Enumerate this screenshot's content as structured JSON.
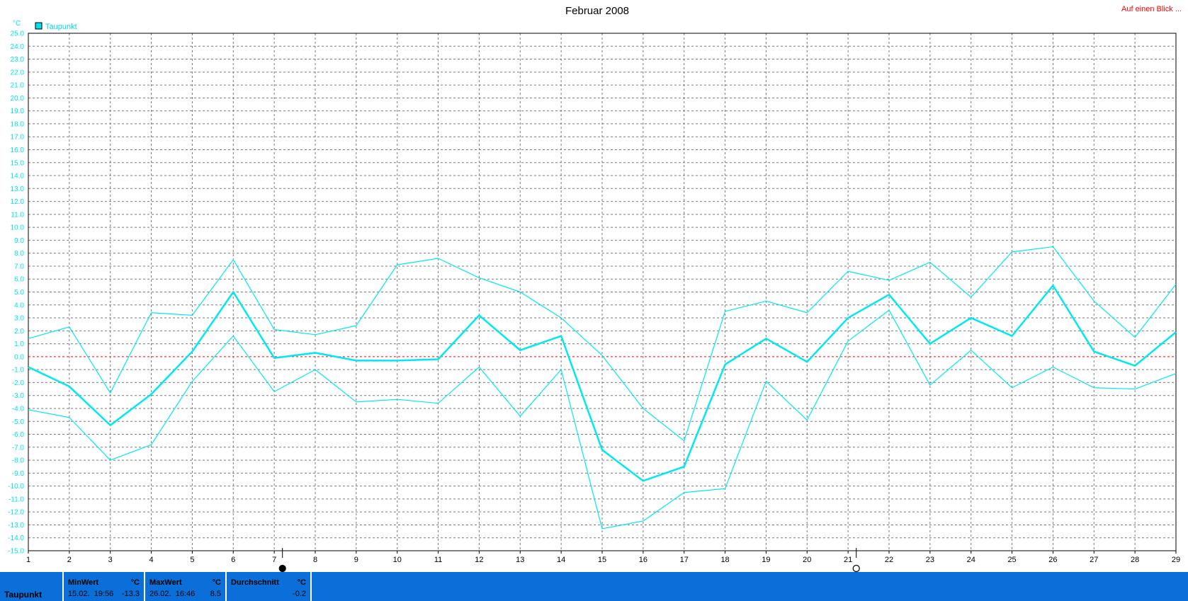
{
  "page_title": "Februar 2008",
  "link_label": "Auf einen Blick ...",
  "y_unit": "°C",
  "colors": {
    "series": "#00e8f0",
    "zero_line": "#ff0000",
    "grid": "#7a7a7a",
    "stats_bar": "#0a6fd8"
  },
  "chart_data": {
    "type": "line",
    "title": "Februar 2008",
    "ylabel": "°C",
    "xlabel": "",
    "ylim": [
      -15,
      25
    ],
    "y_tick_step": 1,
    "grid": true,
    "legend": {
      "placement": "top-left",
      "entries": [
        "Taupunkt"
      ]
    },
    "x": [
      1,
      2,
      3,
      4,
      5,
      6,
      7,
      8,
      9,
      10,
      11,
      12,
      13,
      14,
      15,
      16,
      17,
      18,
      19,
      20,
      21,
      22,
      23,
      24,
      25,
      26,
      27,
      28,
      29
    ],
    "series": [
      {
        "name": "Taupunkt",
        "role": "mean",
        "values": [
          -0.8,
          -2.3,
          -5.3,
          -2.9,
          0.4,
          5.0,
          -0.1,
          0.3,
          -0.3,
          -0.3,
          -0.2,
          3.2,
          0.5,
          1.6,
          -7.2,
          -9.6,
          -8.5,
          -0.6,
          1.4,
          -0.4,
          3.0,
          4.8,
          1.0,
          3.0,
          1.6,
          5.5,
          0.4,
          -0.7,
          1.9
        ]
      },
      {
        "role": "max",
        "values": [
          1.4,
          2.3,
          -2.8,
          3.4,
          3.2,
          7.5,
          2.1,
          1.7,
          2.4,
          7.1,
          7.6,
          6.1,
          5.0,
          3.0,
          0.1,
          -4.0,
          -6.5,
          3.5,
          4.3,
          3.4,
          6.6,
          5.9,
          7.3,
          4.6,
          8.1,
          8.5,
          4.3,
          1.5,
          5.6
        ]
      },
      {
        "role": "min",
        "values": [
          -4.1,
          -4.7,
          -8.0,
          -6.8,
          -1.9,
          1.6,
          -2.7,
          -1.0,
          -3.5,
          -3.3,
          -3.6,
          -0.8,
          -4.6,
          -1.0,
          -13.3,
          -12.7,
          -10.5,
          -10.2,
          -1.9,
          -4.9,
          1.2,
          3.6,
          -2.2,
          0.5,
          -2.4,
          -0.8,
          -2.4,
          -2.5,
          -1.3
        ]
      }
    ],
    "markers": [
      {
        "x": 7.2,
        "symbol": "new-moon"
      },
      {
        "x": 21.2,
        "symbol": "full-moon"
      }
    ]
  },
  "stats": {
    "series_label": "Taupunkt",
    "min": {
      "header": "MinWert",
      "unit": "°C",
      "timestamp": "15.02.  19:56",
      "value": "-13.3"
    },
    "max": {
      "header": "MaxWert",
      "unit": "°C",
      "timestamp": "26.02.  16:46",
      "value": "8.5"
    },
    "avg": {
      "header": "Durchschnitt",
      "unit": "°C",
      "timestamp": "",
      "value": "-0.2"
    }
  }
}
